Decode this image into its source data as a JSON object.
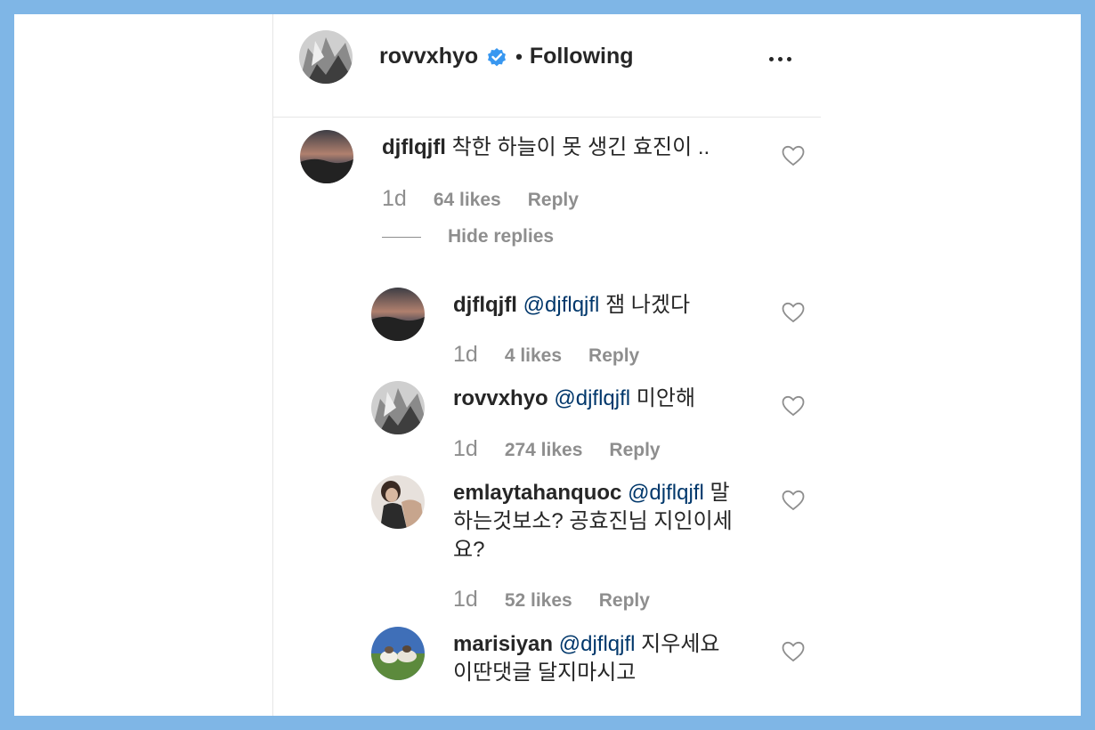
{
  "header": {
    "username": "rovvxhyo",
    "separator": "•",
    "follow_status": "Following"
  },
  "comment": {
    "username": "djflqjfl",
    "text": "착한 하늘이 못 생긴 효진이 ..",
    "time": "1d",
    "likes": "64 likes",
    "reply": "Reply",
    "hide_replies": "Hide replies"
  },
  "replies": [
    {
      "username": "djflqjfl",
      "mention": "@djflqjfl",
      "text": "잼 나겠다",
      "time": "1d",
      "likes": "4 likes",
      "reply": "Reply"
    },
    {
      "username": "rovvxhyo",
      "mention": "@djflqjfl",
      "text": "미안해",
      "time": "1d",
      "likes": "274 likes",
      "reply": "Reply"
    },
    {
      "username": "emlaytahanquoc",
      "mention": "@djflqjfl",
      "text_line1_end": "말",
      "text_line2": "하는것보소? 공효진님 지인이세",
      "text_line3": "요?",
      "time": "1d",
      "likes": "52 likes",
      "reply": "Reply"
    },
    {
      "username": "marisiyan",
      "mention": "@djflqjfl",
      "text_line1_end": "지우세요",
      "text_line2": "이딴댓글 달지마시고"
    }
  ],
  "colors": {
    "background_frame": "#7fb6e6",
    "primary_text": "#262626",
    "secondary_text": "#8e8e8e",
    "mention": "#00376b",
    "verified": "#3897f0"
  }
}
